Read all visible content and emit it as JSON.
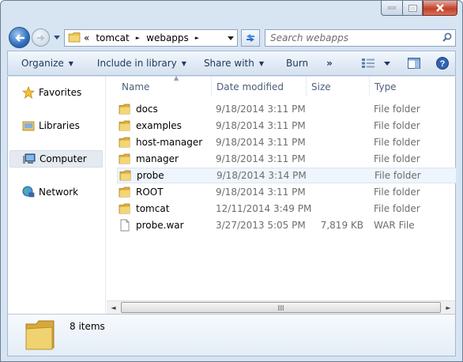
{
  "window": {
    "caption_buttons": {
      "minimize": "minimize-icon",
      "maximize": "maximize-icon",
      "close": "close-icon"
    }
  },
  "address_bar": {
    "overflow": "«",
    "crumbs": [
      "tomcat",
      "webapps"
    ],
    "separator": "►"
  },
  "search": {
    "placeholder": "Search webapps"
  },
  "toolbar": {
    "organize": "Organize",
    "include_in_library": "Include in library",
    "share_with": "Share with",
    "burn": "Burn",
    "more": "»"
  },
  "nav_pane": {
    "items": [
      {
        "label": "Favorites",
        "icon": "star-icon"
      },
      {
        "label": "Libraries",
        "icon": "libraries-icon"
      },
      {
        "label": "Computer",
        "icon": "computer-icon",
        "selected": true
      },
      {
        "label": "Network",
        "icon": "network-icon"
      }
    ]
  },
  "columns": {
    "name": "Name",
    "date": "Date modified",
    "size": "Size",
    "type": "Type"
  },
  "files": [
    {
      "name": "docs",
      "date": "9/18/2014 3:11 PM",
      "size": "",
      "type": "File folder",
      "kind": "folder"
    },
    {
      "name": "examples",
      "date": "9/18/2014 3:11 PM",
      "size": "",
      "type": "File folder",
      "kind": "folder"
    },
    {
      "name": "host-manager",
      "date": "9/18/2014 3:11 PM",
      "size": "",
      "type": "File folder",
      "kind": "folder"
    },
    {
      "name": "manager",
      "date": "9/18/2014 3:11 PM",
      "size": "",
      "type": "File folder",
      "kind": "folder"
    },
    {
      "name": "probe",
      "date": "9/18/2014 3:14 PM",
      "size": "",
      "type": "File folder",
      "kind": "folder",
      "selected": true
    },
    {
      "name": "ROOT",
      "date": "9/18/2014 3:11 PM",
      "size": "",
      "type": "File folder",
      "kind": "folder"
    },
    {
      "name": "tomcat",
      "date": "12/11/2014 3:49 PM",
      "size": "",
      "type": "File folder",
      "kind": "folder"
    },
    {
      "name": "probe.war",
      "date": "3/27/2013 5:05 PM",
      "size": "7,819 KB",
      "type": "WAR File",
      "kind": "file"
    }
  ],
  "status": {
    "item_count": "8 items"
  },
  "colors": {
    "folder": "#e8c14f",
    "selection": "#eef5fc",
    "toolbar_text": "#1e395b"
  }
}
